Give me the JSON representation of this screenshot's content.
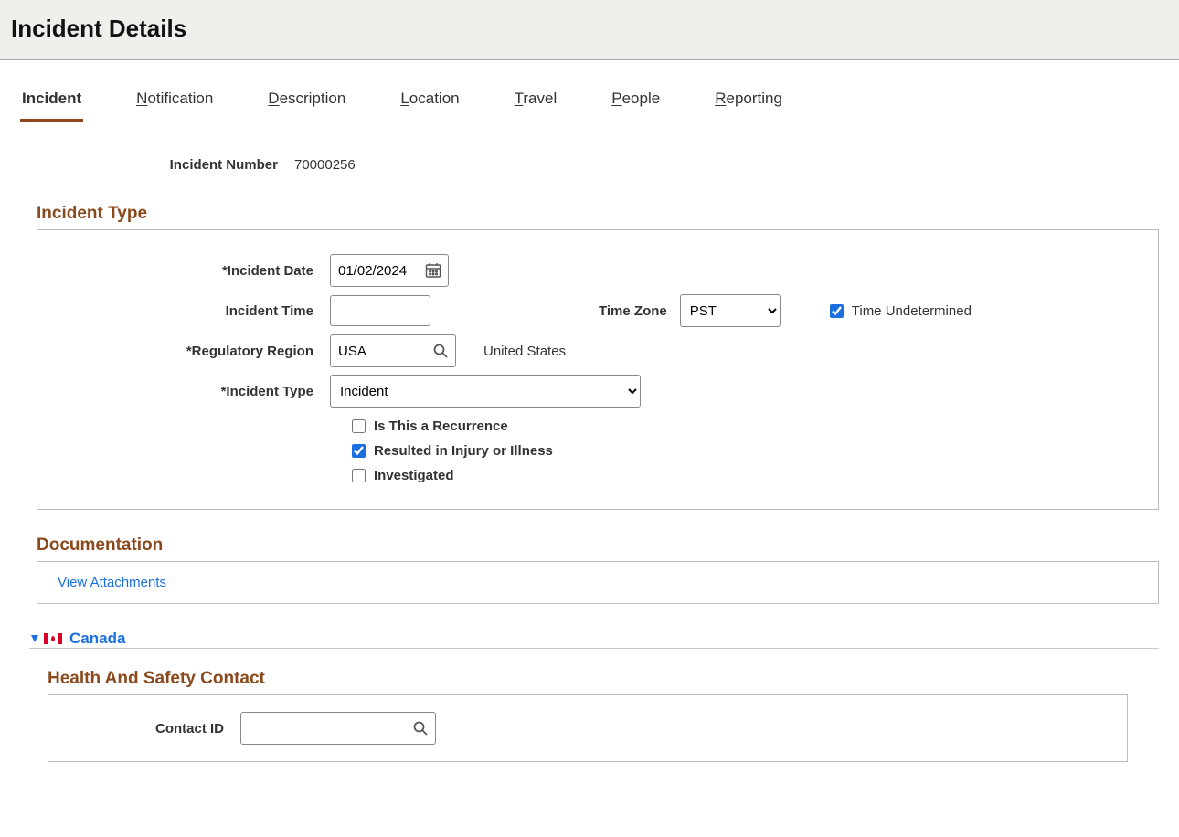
{
  "page_title": "Incident Details",
  "tabs": [
    {
      "label": "Incident",
      "key": "I",
      "rest": "ncident",
      "active": true
    },
    {
      "label": "Notification",
      "key": "N",
      "rest": "otification"
    },
    {
      "label": "Description",
      "key": "D",
      "rest": "escription"
    },
    {
      "label": "Location",
      "key": "L",
      "rest": "ocation"
    },
    {
      "label": "Travel",
      "key": "T",
      "rest": "ravel"
    },
    {
      "label": "People",
      "key": "P",
      "rest": "eople"
    },
    {
      "label": "Reporting",
      "key": "R",
      "rest": "eporting"
    }
  ],
  "incident_number_label": "Incident Number",
  "incident_number_value": "70000256",
  "sections": {
    "incident_type": {
      "title": "Incident Type",
      "fields": {
        "incident_date_label": "*Incident Date",
        "incident_date_value": "01/02/2024",
        "incident_time_label": "Incident Time",
        "incident_time_value": "",
        "time_zone_label": "Time Zone",
        "time_zone_value": "PST",
        "time_undetermined_label": "Time Undetermined",
        "time_undetermined_checked": true,
        "regulatory_region_label": "*Regulatory Region",
        "regulatory_region_value": "USA",
        "regulatory_region_display": "United States",
        "incident_type_label": "*Incident Type",
        "incident_type_value": "Incident",
        "is_recurrence_label": "Is This a Recurrence",
        "is_recurrence_checked": false,
        "resulted_injury_label": "Resulted in Injury or Illness",
        "resulted_injury_checked": true,
        "investigated_label": "Investigated",
        "investigated_checked": false
      }
    },
    "documentation": {
      "title": "Documentation",
      "view_attachments_label": "View Attachments"
    },
    "canada": {
      "label": "Canada"
    },
    "health_safety": {
      "title": "Health And Safety Contact",
      "contact_id_label": "Contact ID",
      "contact_id_value": ""
    }
  }
}
